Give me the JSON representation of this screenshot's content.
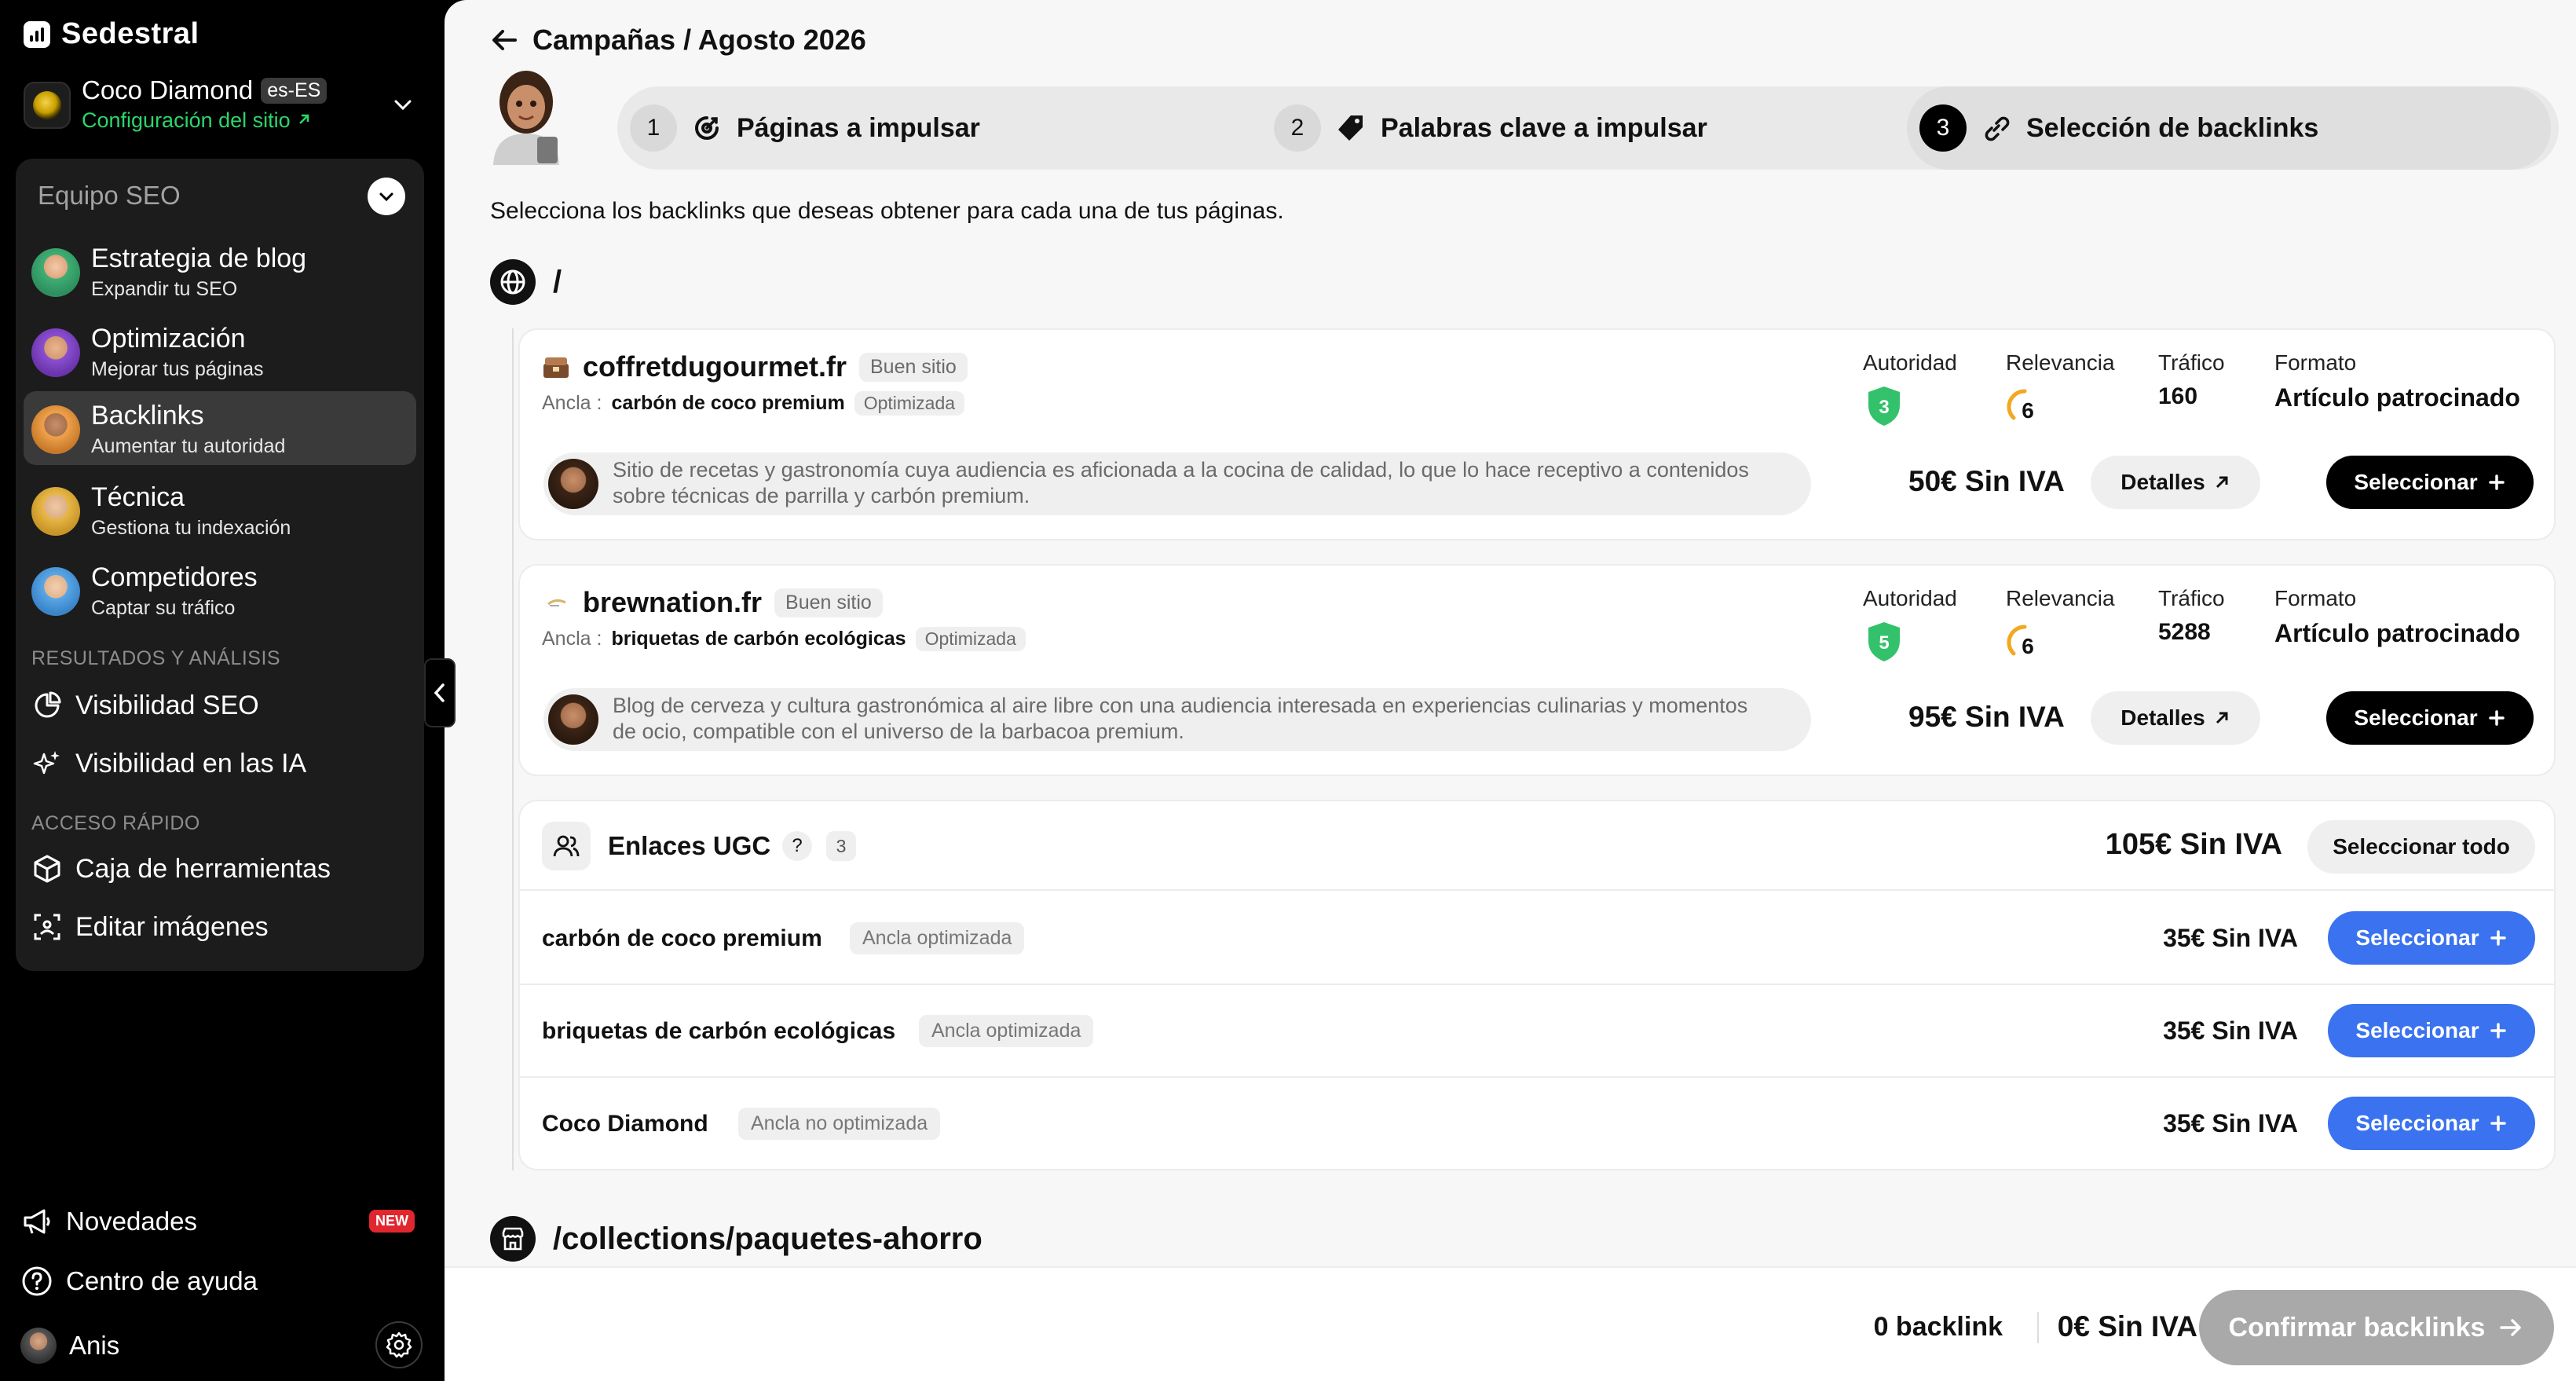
{
  "brand": {
    "name": "Sedestral"
  },
  "site": {
    "name": "Coco Diamond",
    "lang": "es-ES",
    "config_link": "Configuración del sitio"
  },
  "team": {
    "title": "Equipo SEO",
    "agents": [
      {
        "name": "Estrategia de blog",
        "subtitle": "Expandir tu SEO",
        "active": false
      },
      {
        "name": "Optimización",
        "subtitle": "Mejorar tus páginas",
        "active": false
      },
      {
        "name": "Backlinks",
        "subtitle": "Aumentar tu autoridad",
        "active": true
      },
      {
        "name": "Técnica",
        "subtitle": "Gestiona tu indexación",
        "active": false
      },
      {
        "name": "Competidores",
        "subtitle": "Captar su tráfico",
        "active": false
      }
    ],
    "results_section": "RESULTADOS Y ANÁLISIS",
    "results_items": [
      {
        "label": "Visibilidad SEO",
        "icon": "pie-chart-icon"
      },
      {
        "label": "Visibilidad en las IA",
        "icon": "sparkles-icon"
      }
    ],
    "quick_section": "ACCESO RÁPIDO",
    "quick_items": [
      {
        "label": "Caja de herramientas",
        "icon": "box-icon"
      },
      {
        "label": "Editar imágenes",
        "icon": "image-edit-icon"
      }
    ]
  },
  "sidebar_bottom": {
    "news": "Novedades",
    "news_badge": "NEW",
    "help": "Centro de ayuda",
    "user": "Anis"
  },
  "header": {
    "breadcrumb": "Campañas / Agosto 2026"
  },
  "steps": [
    {
      "num": "1",
      "label": "Páginas a impulsar",
      "icon": "target-icon",
      "active": false
    },
    {
      "num": "2",
      "label": "Palabras clave a impulsar",
      "icon": "tag-icon",
      "active": false
    },
    {
      "num": "3",
      "label": "Selección de backlinks",
      "icon": "link-icon",
      "active": true
    }
  ],
  "intro": "Selecciona los backlinks que deseas obtener para cada una de tus páginas.",
  "pages": [
    {
      "path": "/",
      "icon": "globe-icon"
    },
    {
      "path": "/collections/paquetes-ahorro",
      "icon": "store-icon"
    }
  ],
  "metric_labels": {
    "authority": "Autoridad",
    "relevance": "Relevancia",
    "traffic": "Tráfico",
    "format": "Formato"
  },
  "anchor_label": "Ancla :",
  "details_label": "Detalles",
  "select_label": "Seleccionar",
  "offers": [
    {
      "domain": "coffretdugourmet.fr",
      "quality": "Buen sitio",
      "anchor": "carbón de coco premium",
      "anchor_tag": "Optimizada",
      "authority": "3",
      "relevance": "6",
      "traffic": "160",
      "format": "Artículo patrocinado",
      "description": "Sitio de recetas y gastronomía cuya audiencia es aficionada a la cocina de calidad, lo que lo hace receptivo a contenidos sobre técnicas de parrilla y carbón premium.",
      "price": "50€ Sin IVA"
    },
    {
      "domain": "brewnation.fr",
      "quality": "Buen sitio",
      "anchor": "briquetas de carbón ecológicas",
      "anchor_tag": "Optimizada",
      "authority": "5",
      "relevance": "6",
      "traffic": "5288",
      "format": "Artículo patrocinado",
      "description": "Blog de cerveza y cultura gastronómica al aire libre con una audiencia interesada en experiencias culinarias y momentos de ocio, compatible con el universo de la barbacoa premium.",
      "price": "95€ Sin IVA"
    }
  ],
  "ugc": {
    "title": "Enlaces UGC",
    "help": "?",
    "count": "3",
    "total": "105€ Sin IVA",
    "select_all": "Seleccionar todo",
    "rows": [
      {
        "keyword": "carbón de coco premium",
        "tag": "Ancla optimizada",
        "price": "35€ Sin IVA"
      },
      {
        "keyword": "briquetas de carbón ecológicas",
        "tag": "Ancla optimizada",
        "price": "35€ Sin IVA"
      },
      {
        "keyword": "Coco Diamond",
        "tag": "Ancla no optimizada",
        "price": "35€ Sin IVA"
      }
    ]
  },
  "footer": {
    "count": "0 backlink",
    "price": "0€ Sin IVA",
    "confirm": "Confirmar backlinks"
  },
  "colors": {
    "accent_blue": "#3a72f0",
    "authority_green": "#33c26b",
    "relevance_orange": "#f2a81f",
    "config_green": "#2bd66b",
    "new_badge_red": "#e0262f"
  }
}
